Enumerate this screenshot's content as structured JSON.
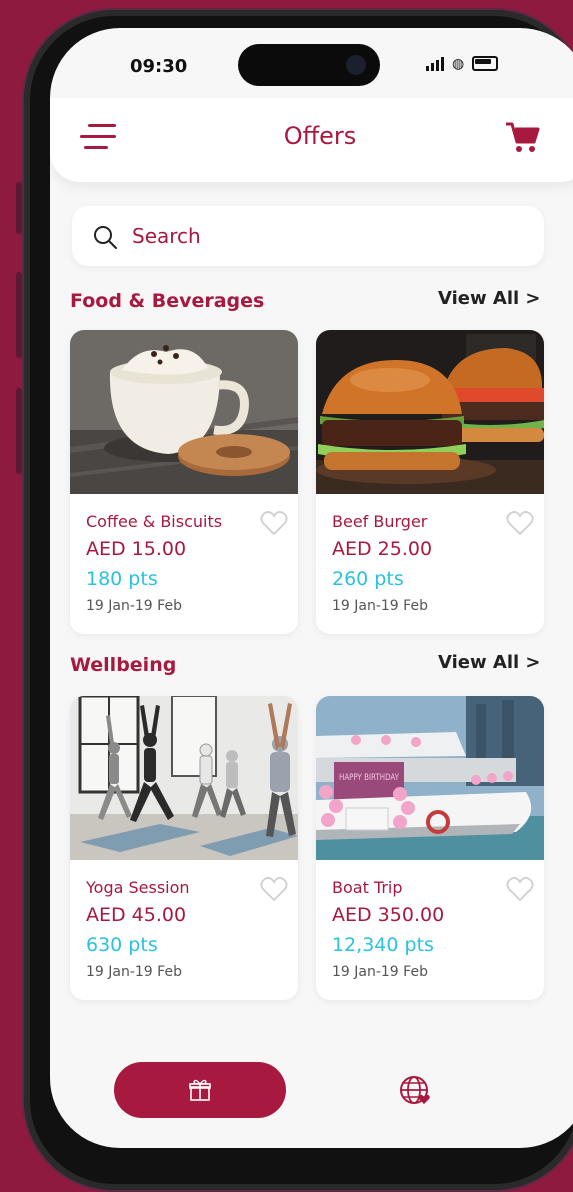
{
  "status_bar": {
    "time": "09:30"
  },
  "header": {
    "title": "Offers",
    "menu_icon": "menu-icon",
    "cart_icon": "cart-icon"
  },
  "search": {
    "placeholder": "Search",
    "icon": "search-icon"
  },
  "sections": [
    {
      "title": "Food & Beverages",
      "view_all": "View All >",
      "items": [
        {
          "name": "Coffee & Biscuits",
          "price": "AED 15.00",
          "points": "180 pts",
          "dates": "19 Jan-19 Feb"
        },
        {
          "name": "Beef Burger",
          "price": "AED 25.00",
          "points": "260 pts",
          "dates": "19 Jan-19 Feb"
        }
      ]
    },
    {
      "title": "Wellbeing",
      "view_all": "View All >",
      "items": [
        {
          "name": "Yoga Session",
          "price": "AED 45.00",
          "points": "630 pts",
          "dates": "19 Jan-19 Feb"
        },
        {
          "name": "Boat Trip",
          "price": "AED 350.00",
          "points": "12,340 pts",
          "dates": "19 Jan-19 Feb",
          "image_text": "HAPPY BIRTHDAY"
        }
      ]
    }
  ],
  "bottom_nav": {
    "gift_icon": "gift-icon",
    "globe_icon": "globe-icon"
  },
  "colors": {
    "brand": "#a8193f",
    "points": "#2ac2e0",
    "background": "#8e1a3f"
  }
}
